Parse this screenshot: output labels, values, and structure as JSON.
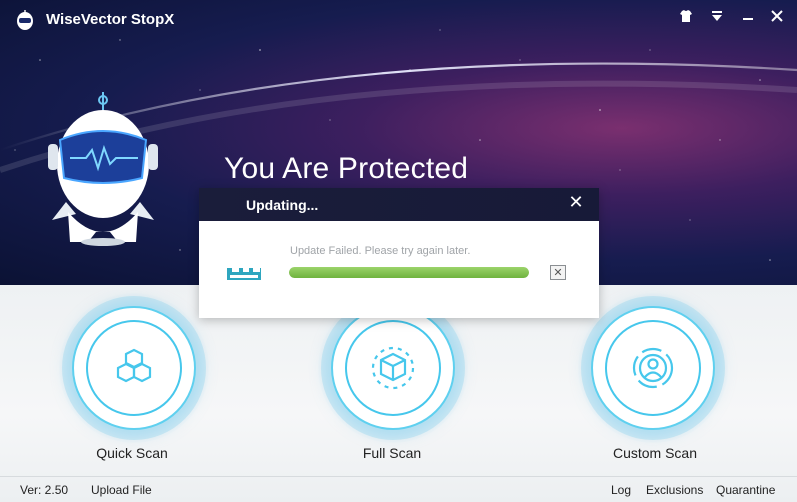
{
  "window": {
    "title": "WiseVector StopX",
    "controls": {
      "skin_icon": "tshirt-icon",
      "menu_icon": "menu-down-icon",
      "minimize_icon": "minimize-icon",
      "close_icon": "close-icon"
    }
  },
  "hero": {
    "status_title": "You Are Protected"
  },
  "scans": {
    "quick": {
      "label": "Quick Scan",
      "icon": "hexagon-molecule-icon"
    },
    "full": {
      "label": "Full Scan",
      "icon": "cube-icon"
    },
    "custom": {
      "label": "Custom Scan",
      "icon": "user-target-icon"
    }
  },
  "footer": {
    "version": "Ver: 2.50",
    "upload": "Upload File",
    "log": "Log",
    "exclusions": "Exclusions",
    "quarantine": "Quarantine"
  },
  "dialog": {
    "title": "Updating...",
    "message": "Update Failed. Please try again later.",
    "progress_percent": 100,
    "close_symbol": "✕",
    "cancel_symbol": "✕"
  },
  "colors": {
    "accent": "#46c7ec",
    "progress": "#7cc04a",
    "dialog_header": "#1a1d3a"
  }
}
